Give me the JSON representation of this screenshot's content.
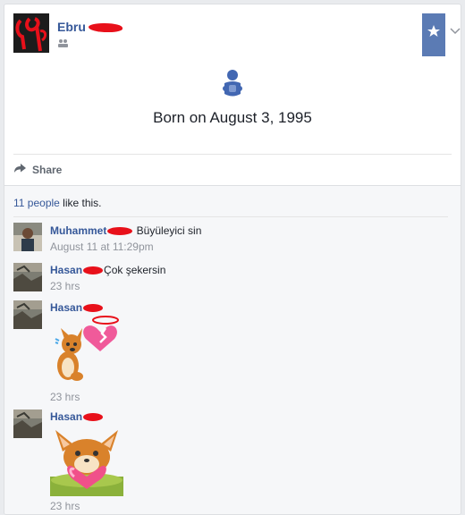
{
  "post": {
    "author": "Ebru",
    "privacy": "friends-icon",
    "life_event": {
      "icon": "baby-icon",
      "text": "Born on August 3, 1995"
    },
    "actions": {
      "share_label": "Share"
    }
  },
  "ufi": {
    "likes_count": "11 people",
    "likes_suffix": " like this."
  },
  "comments": [
    {
      "author": "Muhammet",
      "text": " Büyüleyici sin",
      "time": "August 11 at 11:29pm"
    },
    {
      "author": "Hasan",
      "text": "Çok şekersin",
      "time": "23 hrs"
    },
    {
      "author": "Hasan",
      "text": "",
      "time": "23 hrs",
      "sticker": "broken-heart-fox-sticker"
    },
    {
      "author": "Hasan",
      "text": "",
      "time": "23 hrs",
      "sticker": "heart-fox-sticker"
    }
  ],
  "colors": {
    "link": "#365899",
    "bookmark": "#5b7bb4",
    "muted": "#90949c",
    "baby_icon": "#4267b2"
  }
}
